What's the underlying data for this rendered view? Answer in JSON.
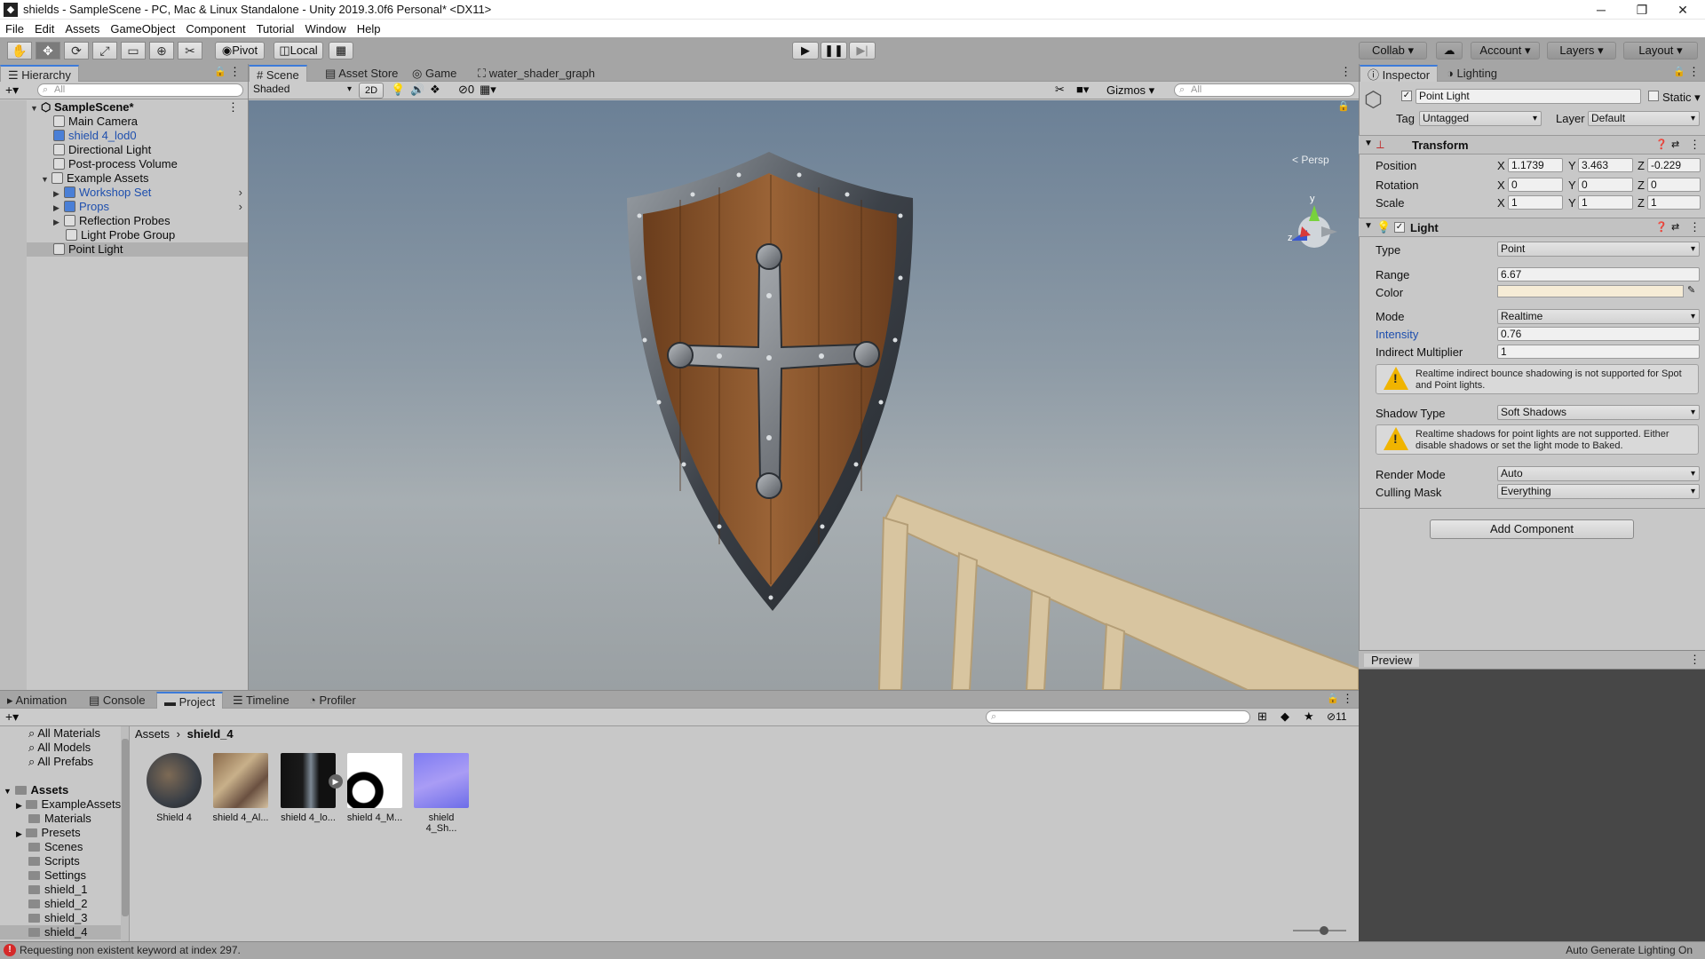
{
  "window": {
    "title": "shields - SampleScene - PC, Mac & Linux Standalone - Unity 2019.3.0f6 Personal* <DX11>",
    "controls": [
      "─",
      "❐",
      "✕"
    ]
  },
  "menu": [
    "File",
    "Edit",
    "Assets",
    "GameObject",
    "Component",
    "Tutorial",
    "Window",
    "Help"
  ],
  "toolbar": {
    "tools": [
      "hand-tool",
      "move-tool",
      "rotate-tool",
      "scale-tool",
      "rect-tool",
      "transform-tool",
      "custom-tool"
    ],
    "pivot": "Pivot",
    "local": "Local",
    "collab": "Collab ▾",
    "account": "Account",
    "layers": "Layers",
    "layout": "Layout"
  },
  "hierarchy": {
    "tab": "Hierarchy",
    "search_placeholder": "All",
    "scene": "SampleScene*",
    "items": [
      {
        "label": "Main Camera",
        "depth": 1
      },
      {
        "label": "shield 4_lod0",
        "depth": 1,
        "prefab": true
      },
      {
        "label": "Directional Light",
        "depth": 1
      },
      {
        "label": "Post-process Volume",
        "depth": 1
      },
      {
        "label": "Example Assets",
        "depth": 1,
        "expanded": true
      },
      {
        "label": "Workshop Set",
        "depth": 2,
        "prefab": true
      },
      {
        "label": "Props",
        "depth": 2,
        "prefab": true
      },
      {
        "label": "Reflection Probes",
        "depth": 2
      },
      {
        "label": "Light Probe Group",
        "depth": 2
      },
      {
        "label": "Point Light",
        "depth": 1,
        "selected": true
      }
    ]
  },
  "scene": {
    "tabs": [
      "Scene",
      "Asset Store",
      "Game",
      "water_shader_graph"
    ],
    "shading": "Shaded",
    "mode2d": "2D",
    "hidden_count": "0",
    "gizmos": "Gizmos",
    "search_placeholder": "All",
    "persp": "< Persp"
  },
  "inspector": {
    "tabs": [
      "Inspector",
      "Lighting"
    ],
    "object_name": "Point Light",
    "static_label": "Static",
    "tag_label": "Tag",
    "tag": "Untagged",
    "layer_label": "Layer",
    "layer": "Default",
    "transform": {
      "title": "Transform",
      "position_label": "Position",
      "rotation_label": "Rotation",
      "scale_label": "Scale",
      "position": {
        "x": "1.1739",
        "y": "3.463",
        "z": "-0.229"
      },
      "rotation": {
        "x": "0",
        "y": "0",
        "z": "0"
      },
      "scale": {
        "x": "1",
        "y": "1",
        "z": "1"
      }
    },
    "light": {
      "title": "Light",
      "type_label": "Type",
      "type": "Point",
      "range_label": "Range",
      "range": "6.67",
      "color_label": "Color",
      "color": "#f6ecd6",
      "mode_label": "Mode",
      "mode": "Realtime",
      "intensity_label": "Intensity",
      "intensity": "0.76",
      "indirect_label": "Indirect Multiplier",
      "indirect": "1",
      "warning1": "Realtime indirect bounce shadowing is not supported for Spot and Point lights.",
      "shadow_label": "Shadow Type",
      "shadow": "Soft Shadows",
      "warning2": "Realtime shadows for point lights are not supported. Either disable shadows or set the light mode to Baked.",
      "render_label": "Render Mode",
      "render": "Auto",
      "culling_label": "Culling Mask",
      "culling": "Everything"
    },
    "add_component": "Add Component",
    "preview": "Preview"
  },
  "bottom": {
    "tabs": [
      "Animation",
      "Console",
      "Project",
      "Timeline",
      "Profiler"
    ],
    "hidden_count": "11",
    "favorites": [
      "All Materials",
      "All Models",
      "All Prefabs"
    ],
    "assets_root": "Assets",
    "folders": [
      "ExampleAssets",
      "Materials",
      "Presets",
      "Scenes",
      "Scripts",
      "Settings",
      "shield_1",
      "shield_2",
      "shield_3",
      "shield_4"
    ],
    "breadcrumb": [
      "Assets",
      "shield_4"
    ],
    "assets": [
      "Shield 4",
      "shield 4_Al...",
      "shield 4_lo...",
      "shield 4_M...",
      "shield 4_Sh..."
    ]
  },
  "status": {
    "error": "Requesting non existent keyword at index 297.",
    "right": "Auto Generate Lighting On"
  }
}
